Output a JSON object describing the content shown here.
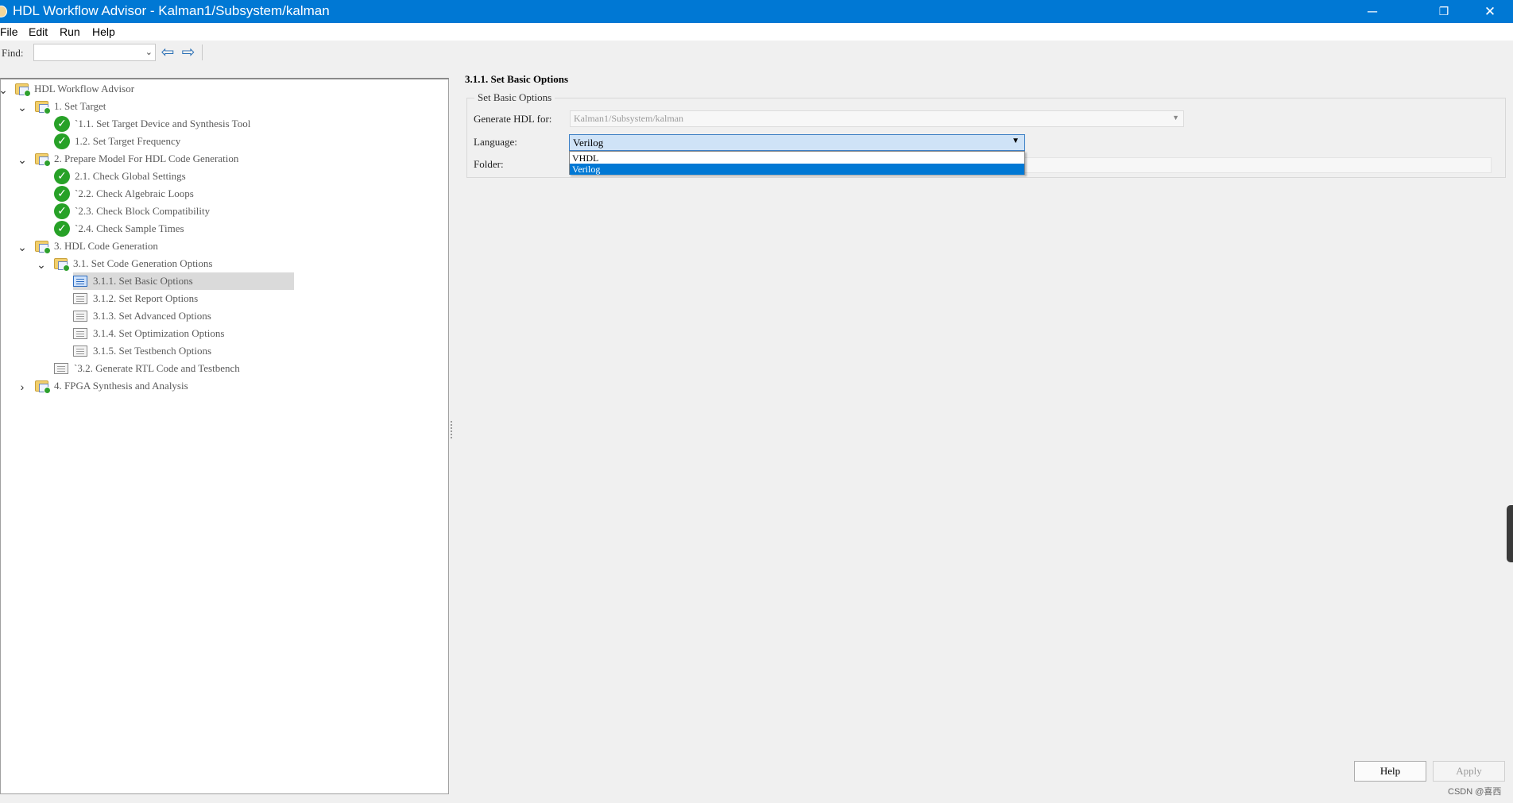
{
  "window": {
    "title": "HDL Workflow Advisor - Kalman1/Subsystem/kalman",
    "minimize_glyph": "─",
    "restore_glyph": "❐",
    "close_glyph": "✕"
  },
  "menu": [
    "File",
    "Edit",
    "Run",
    "Help"
  ],
  "toolbar": {
    "find_label": "Find:",
    "find_value": "",
    "back_icon": "back-arrow-icon",
    "forward_icon": "forward-arrow-icon"
  },
  "tree": [
    {
      "label": "HDL Workflow Advisor",
      "icon": "folder-icon",
      "expanded": true
    },
    {
      "label": "1. Set Target",
      "icon": "folder-icon",
      "expanded": true
    },
    {
      "label": "`1.1. Set Target Device and Synthesis Tool",
      "icon": "check-icon"
    },
    {
      "label": "1.2. Set Target Frequency",
      "icon": "check-icon"
    },
    {
      "label": "2. Prepare Model For HDL Code Generation",
      "icon": "folder-icon",
      "expanded": true
    },
    {
      "label": "2.1. Check Global Settings",
      "icon": "check-icon"
    },
    {
      "label": "`2.2. Check Algebraic Loops",
      "icon": "check-icon"
    },
    {
      "label": "`2.3. Check Block Compatibility",
      "icon": "check-icon"
    },
    {
      "label": "`2.4. Check Sample Times",
      "icon": "check-icon"
    },
    {
      "label": "3. HDL Code Generation",
      "icon": "folder-icon",
      "expanded": true
    },
    {
      "label": "3.1. Set Code Generation Options",
      "icon": "folder-icon",
      "expanded": true
    },
    {
      "label": "3.1.1. Set Basic Options",
      "icon": "task-icon",
      "selected": true
    },
    {
      "label": "3.1.2. Set Report Options",
      "icon": "task-icon"
    },
    {
      "label": "3.1.3. Set Advanced Options",
      "icon": "task-icon"
    },
    {
      "label": "3.1.4. Set Optimization Options",
      "icon": "task-icon"
    },
    {
      "label": "3.1.5. Set Testbench Options",
      "icon": "task-icon"
    },
    {
      "label": "`3.2. Generate RTL Code and Testbench",
      "icon": "task-icon"
    },
    {
      "label": "4. FPGA Synthesis and Analysis",
      "icon": "folder-icon",
      "expanded": false
    }
  ],
  "details": {
    "page_title": "3.1.1. Set Basic Options",
    "group_title": "Set Basic Options",
    "generate_hdl_label": "Generate HDL for:",
    "generate_hdl_value": "Kalman1/Subsystem/kalman",
    "language_label": "Language:",
    "language_value": "Verilog",
    "language_options": [
      "VHDL",
      "Verilog"
    ],
    "folder_label": "Folder:",
    "folder_value": ""
  },
  "buttons": {
    "help": "Help",
    "apply": "Apply"
  },
  "watermark": "CSDN @喜西",
  "colors": {
    "titlebar": "#0078d4",
    "selection": "#0078d4",
    "check": "#27a127"
  }
}
